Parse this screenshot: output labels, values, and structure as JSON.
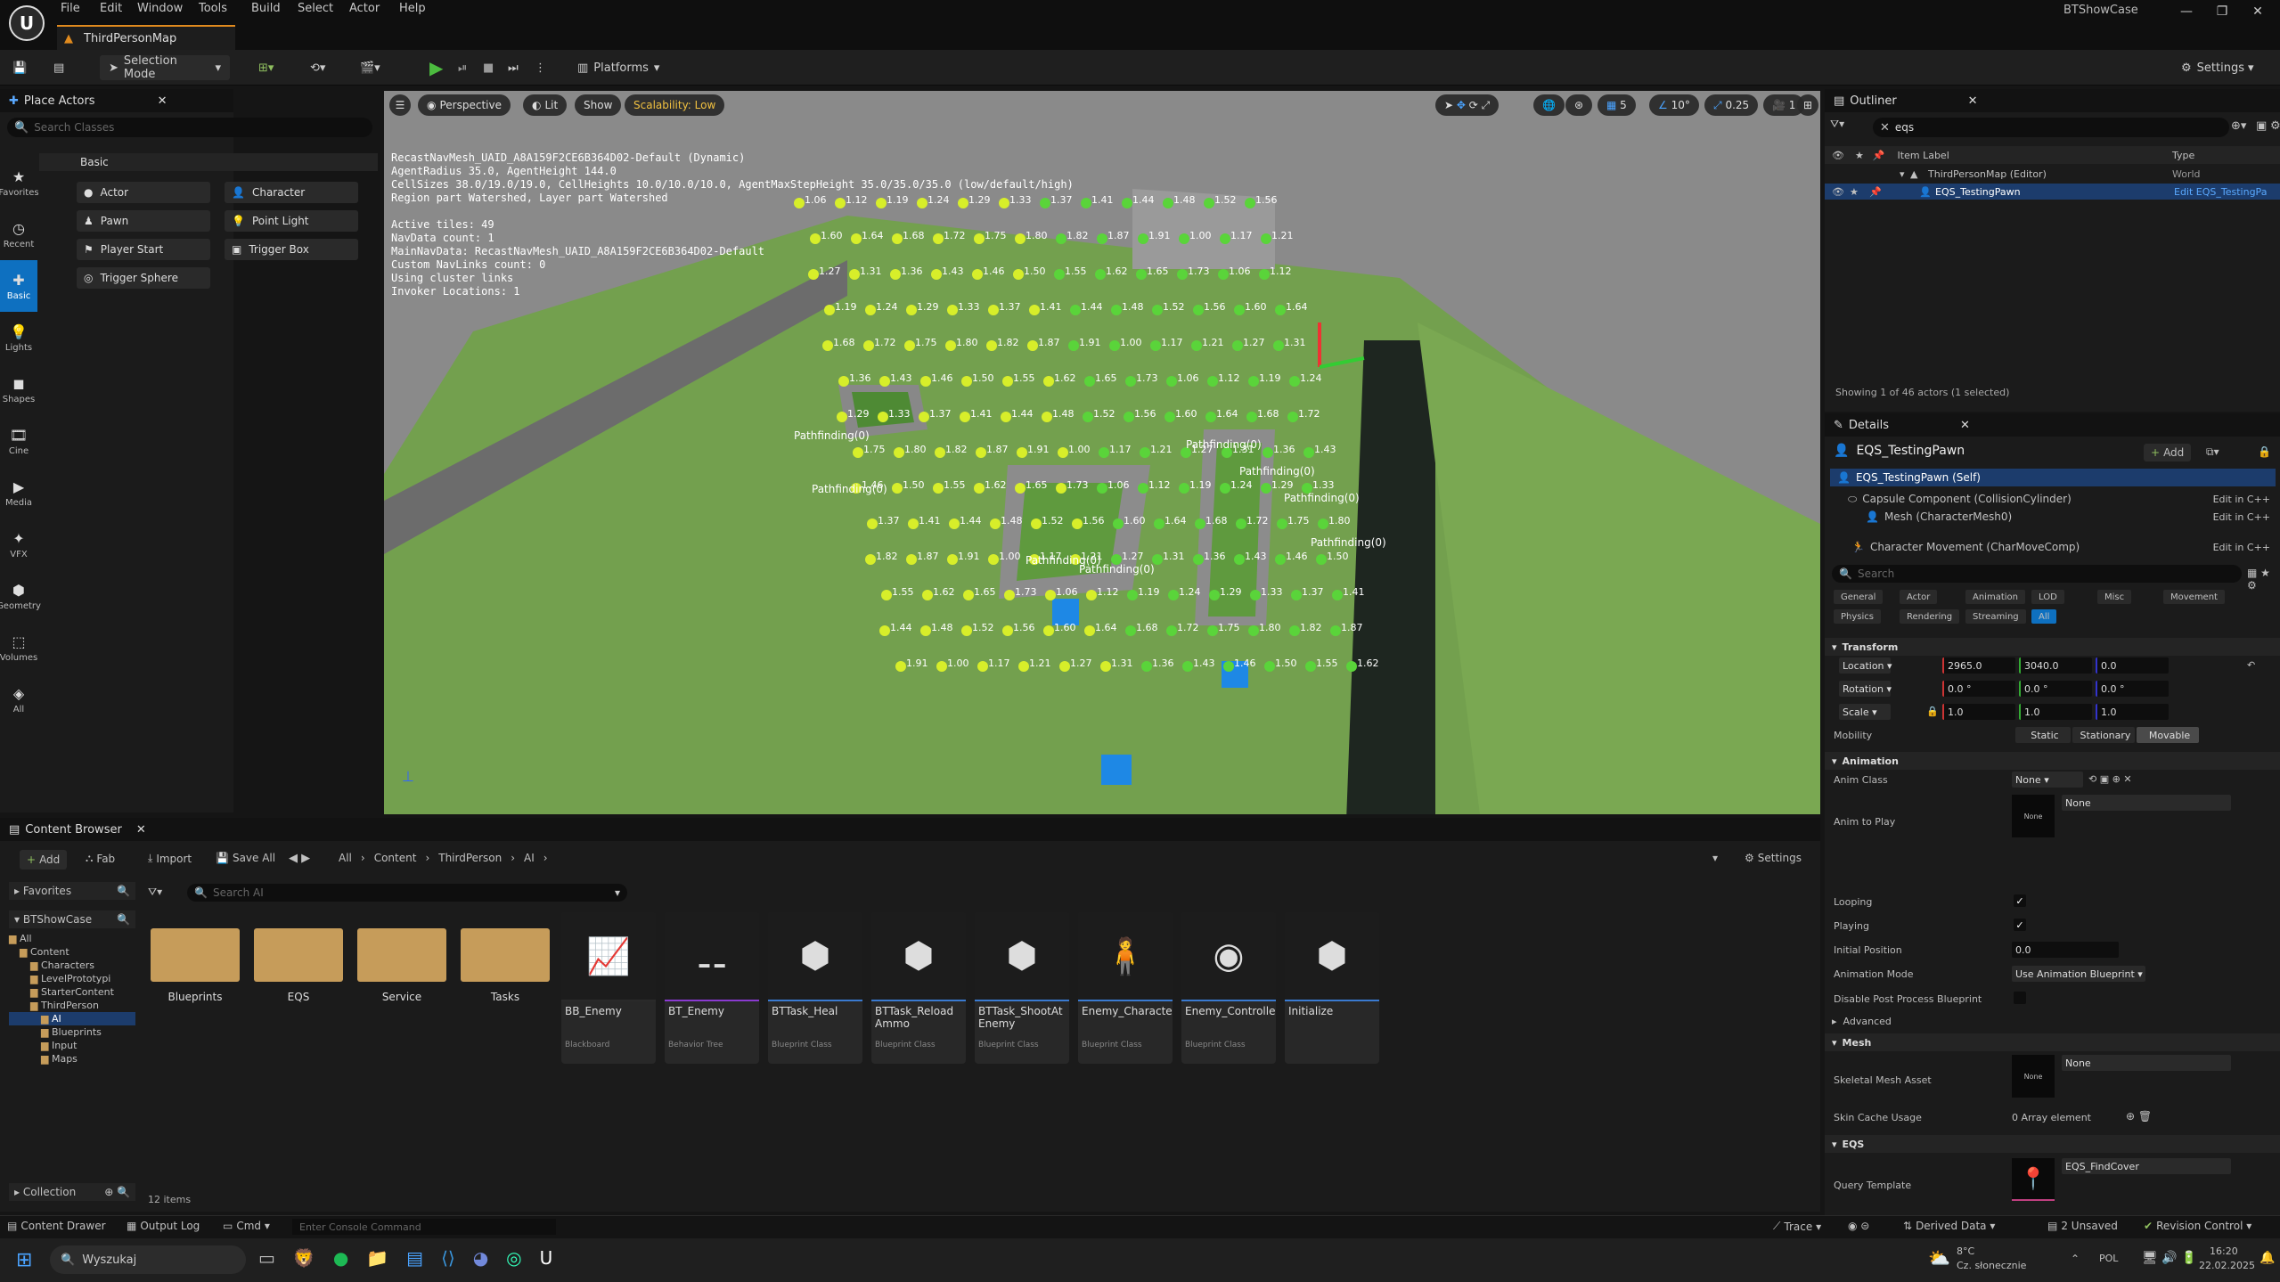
{
  "titlebar": {
    "menu": [
      "File",
      "Edit",
      "Window",
      "Tools",
      "Build",
      "Select",
      "Actor",
      "Help"
    ],
    "map_tab": "ThirdPersonMap",
    "app_title": "BTShowCase"
  },
  "toolbar": {
    "selection_mode": "Selection Mode",
    "platforms": "Platforms",
    "settings": "Settings"
  },
  "place_actors": {
    "tab": "Place Actors",
    "search_placeholder": "Search Classes",
    "group": "Basic",
    "categories": [
      "Favorites",
      "Recent",
      "Basic",
      "Lights",
      "Shapes",
      "Cine",
      "Media",
      "VFX",
      "Geometry",
      "Volumes",
      "All"
    ],
    "actors": [
      "Actor",
      "Character",
      "Pawn",
      "Point Light",
      "Player Start",
      "Trigger Box",
      "Trigger Sphere"
    ]
  },
  "viewport": {
    "perspective": "Perspective",
    "lit": "Lit",
    "show": "Show",
    "scalability": "Scalability: Low",
    "grid": "5",
    "angle": "10°",
    "scale": "0.25",
    "camera": "1",
    "stats": [
      "RecastNavMesh_UAID_A8A159F2CE6B364D02-Default (Dynamic)",
      "AgentRadius 35.0, AgentHeight 144.0",
      "CellSizes 38.0/19.0/19.0, CellHeights 10.0/10.0/10.0, AgentMaxStepHeight 35.0/35.0/35.0 (low/default/high)",
      "Region part Watershed, Layer part Watershed",
      "",
      "Active tiles: 49",
      "NavData count: 1",
      "MainNavData: RecastNavMesh_UAID_A8A159F2CE6B364D02-Default",
      "Custom NavLinks count: 0",
      "Using cluster links",
      "Invoker Locations: 1"
    ],
    "pathfinding": "Pathfinding(0)",
    "point_scores": [
      "1.06",
      "1.12",
      "1.19",
      "1.24",
      "1.29",
      "1.33",
      "1.37",
      "1.41",
      "1.44",
      "1.48",
      "1.52",
      "1.56",
      "1.60",
      "1.64",
      "1.68",
      "1.72",
      "1.75",
      "1.80",
      "1.82",
      "1.87",
      "1.91",
      "1.00",
      "1.17",
      "1.21",
      "1.27",
      "1.31",
      "1.36",
      "1.43",
      "1.46",
      "1.50",
      "1.55",
      "1.62",
      "1.65",
      "1.73"
    ]
  },
  "outliner": {
    "tab": "Outliner",
    "search_value": "eqs",
    "col_label": "Item Label",
    "col_type": "Type",
    "rows": [
      {
        "label": "ThirdPersonMap (Editor)",
        "type": "World"
      },
      {
        "label": "EQS_TestingPawn",
        "type": "Edit EQS_TestingPa"
      }
    ],
    "footer": "Showing 1 of 46 actors (1 selected)"
  },
  "details": {
    "tab": "Details",
    "object": "EQS_TestingPawn",
    "add": "Add",
    "components": [
      {
        "label": "EQS_TestingPawn (Self)",
        "link": ""
      },
      {
        "label": "Capsule Component (CollisionCylinder)",
        "link": "Edit in C++"
      },
      {
        "label": "Mesh (CharacterMesh0)",
        "link": "Edit in C++"
      },
      {
        "label": "Character Movement (CharMoveComp)",
        "link": "Edit in C++"
      }
    ],
    "search_placeholder": "Search",
    "filters_row1": [
      "General",
      "Actor",
      "Animation",
      "LOD",
      "Misc",
      "Movement"
    ],
    "filters_row2": [
      "Physics",
      "Rendering",
      "Streaming",
      "All"
    ],
    "transform": {
      "section": "Transform",
      "location_label": "Location",
      "location": [
        "2965.0",
        "3040.0",
        "0.0"
      ],
      "rotation_label": "Rotation",
      "rotation": [
        "0.0 °",
        "0.0 °",
        "0.0 °"
      ],
      "scale_label": "Scale",
      "scale": [
        "1.0",
        "1.0",
        "1.0"
      ],
      "mobility_label": "Mobility",
      "mobility": [
        "Static",
        "Stationary",
        "Movable"
      ]
    },
    "animation": {
      "section": "Animation",
      "anim_class_label": "Anim Class",
      "anim_class": "None",
      "anim_to_play_label": "Anim to Play",
      "anim_to_play": "None",
      "thumb_none": "None",
      "looping_label": "Looping",
      "playing_label": "Playing",
      "initial_position_label": "Initial Position",
      "initial_position": "0.0",
      "mode_label": "Animation Mode",
      "mode": "Use Animation Blueprint",
      "disable_pp_label": "Disable Post Process Blueprint",
      "advanced": "Advanced"
    },
    "mesh": {
      "section": "Mesh",
      "skeletal_label": "Skeletal Mesh Asset",
      "skeletal": "None",
      "skin_cache_label": "Skin Cache Usage",
      "skin_cache": "0 Array element"
    },
    "eqs": {
      "section": "EQS",
      "query_label": "Query Template",
      "query": "EQS_FindCover"
    }
  },
  "content_browser": {
    "tab": "Content Browser",
    "add": "Add",
    "fab": "Fab",
    "import": "Import",
    "save_all": "Save All",
    "settings": "Settings",
    "breadcrumb": [
      "All",
      "Content",
      "ThirdPerson",
      "AI"
    ],
    "search_placeholder": "Search AI",
    "favorites": "Favorites",
    "project": "BTShowCase",
    "collection": "Collection",
    "tree": [
      "All",
      "Content",
      "Characters",
      "LevelPrototypi",
      "StarterContent",
      "ThirdPerson",
      "AI",
      "Blueprints",
      "Input",
      "Maps"
    ],
    "folders": [
      "Blueprints",
      "EQS",
      "Service",
      "Tasks"
    ],
    "assets": [
      {
        "name": "BB_Enemy",
        "type": "Blackboard",
        "icon": "blackboard-icon"
      },
      {
        "name": "BT_Enemy",
        "type": "Behavior Tree",
        "icon": "behavior-tree-icon"
      },
      {
        "name": "BTTask_Heal",
        "type": "Blueprint Class",
        "icon": "blueprint-icon"
      },
      {
        "name": "BTTask_Reload Ammo",
        "type": "Blueprint Class",
        "icon": "blueprint-icon"
      },
      {
        "name": "BTTask_ShootAt Enemy",
        "type": "Blueprint Class",
        "icon": "blueprint-icon"
      },
      {
        "name": "Enemy_Character",
        "type": "Blueprint Class",
        "icon": "character-icon"
      },
      {
        "name": "Enemy_Controller",
        "type": "Blueprint Class",
        "icon": "controller-icon"
      },
      {
        "name": "Initialize",
        "type": "",
        "icon": "blueprint-icon"
      }
    ],
    "item_count": "12 items"
  },
  "statusbar": {
    "content_drawer": "Content Drawer",
    "output_log": "Output Log",
    "cmd": "Cmd",
    "console_placeholder": "Enter Console Command",
    "trace": "Trace",
    "derived_data": "Derived Data",
    "unsaved": "2 Unsaved",
    "revision": "Revision Control"
  },
  "taskbar": {
    "search": "Wyszukaj",
    "weather_temp": "8°C",
    "weather_desc": "Cz. słonecznie",
    "lang": "POL",
    "time": "16:20",
    "date": "22.02.2025"
  }
}
